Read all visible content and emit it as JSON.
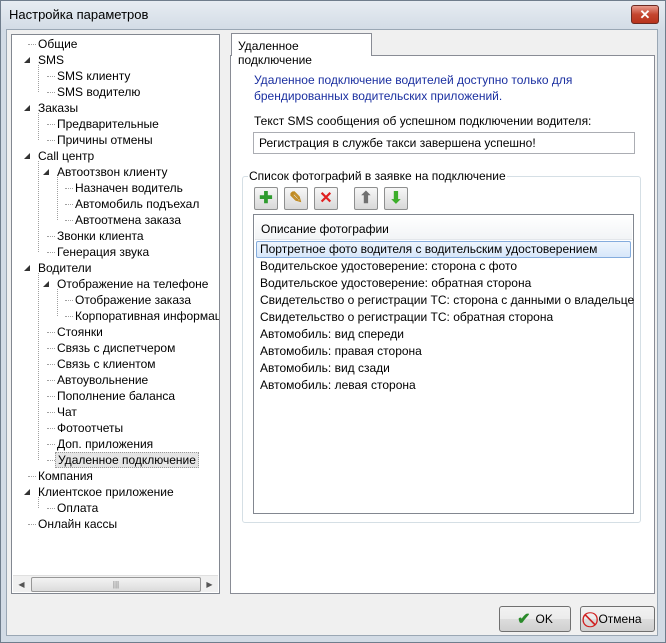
{
  "window": {
    "title": "Настройка параметров",
    "close_icon": "close-icon"
  },
  "tree": [
    {
      "label": "Общие",
      "depth": 0,
      "expandable": false
    },
    {
      "label": "SMS",
      "depth": 0,
      "expandable": true
    },
    {
      "label": "SMS клиенту",
      "depth": 1,
      "expandable": false
    },
    {
      "label": "SMS водителю",
      "depth": 1,
      "expandable": false
    },
    {
      "label": "Заказы",
      "depth": 0,
      "expandable": true
    },
    {
      "label": "Предварительные",
      "depth": 1,
      "expandable": false
    },
    {
      "label": "Причины отмены",
      "depth": 1,
      "expandable": false
    },
    {
      "label": "Call центр",
      "depth": 0,
      "expandable": true
    },
    {
      "label": "Автоотзвон клиенту",
      "depth": 1,
      "expandable": true
    },
    {
      "label": "Назначен водитель",
      "depth": 2,
      "expandable": false
    },
    {
      "label": "Автомобиль подъехал",
      "depth": 2,
      "expandable": false
    },
    {
      "label": "Автоотмена заказа",
      "depth": 2,
      "expandable": false
    },
    {
      "label": "Звонки клиента",
      "depth": 1,
      "expandable": false
    },
    {
      "label": "Генерация звука",
      "depth": 1,
      "expandable": false
    },
    {
      "label": "Водители",
      "depth": 0,
      "expandable": true
    },
    {
      "label": "Отображение на телефоне",
      "depth": 1,
      "expandable": true
    },
    {
      "label": "Отображение заказа",
      "depth": 2,
      "expandable": false
    },
    {
      "label": "Корпоративная информаци",
      "depth": 2,
      "expandable": false
    },
    {
      "label": "Стоянки",
      "depth": 1,
      "expandable": false
    },
    {
      "label": "Связь с диспетчером",
      "depth": 1,
      "expandable": false
    },
    {
      "label": "Связь с клиентом",
      "depth": 1,
      "expandable": false
    },
    {
      "label": "Автоувольнение",
      "depth": 1,
      "expandable": false
    },
    {
      "label": "Пополнение баланса",
      "depth": 1,
      "expandable": false
    },
    {
      "label": "Чат",
      "depth": 1,
      "expandable": false
    },
    {
      "label": "Фотоотчеты",
      "depth": 1,
      "expandable": false
    },
    {
      "label": "Доп. приложения",
      "depth": 1,
      "expandable": false
    },
    {
      "label": "Удаленное подключение",
      "depth": 1,
      "expandable": false,
      "selected": true
    },
    {
      "label": "Компания",
      "depth": 0,
      "expandable": false
    },
    {
      "label": "Клиентское приложение",
      "depth": 0,
      "expandable": true
    },
    {
      "label": "Оплата",
      "depth": 1,
      "expandable": false
    },
    {
      "label": "Онлайн кассы",
      "depth": 0,
      "expandable": false
    }
  ],
  "tab": {
    "label": "Удаленное подключение"
  },
  "panel": {
    "info_line1": "Удаленное подключение водителей доступно только для",
    "info_line2": "брендированных водительских приложений.",
    "sms_label": "Текст SMS сообщения об успешном подключении водителя:",
    "sms_value": "Регистрация в службе такси завершена успешно!",
    "group_label": "Список фотографий в заявке на подключение",
    "list_header": "Описание фотографии",
    "photos": [
      "Портретное фото водителя с водительским удостоверением",
      "Водительское удостоверение: сторона с фото",
      "Водительское удостоверение: обратная сторона",
      "Свидетельство о регистрации ТС: сторона с данными о владельце",
      "Свидетельство о регистрации ТС: обратная сторона",
      "Автомобиль: вид спереди",
      "Автомобиль: правая сторона",
      "Автомобиль: вид сзади",
      "Автомобиль: левая сторона"
    ],
    "selected_photo": 0
  },
  "buttons": {
    "ok": "OK",
    "cancel": "Отмена"
  },
  "colors": {
    "info_text": "#1a2fa0",
    "selection": "#84acdd"
  }
}
